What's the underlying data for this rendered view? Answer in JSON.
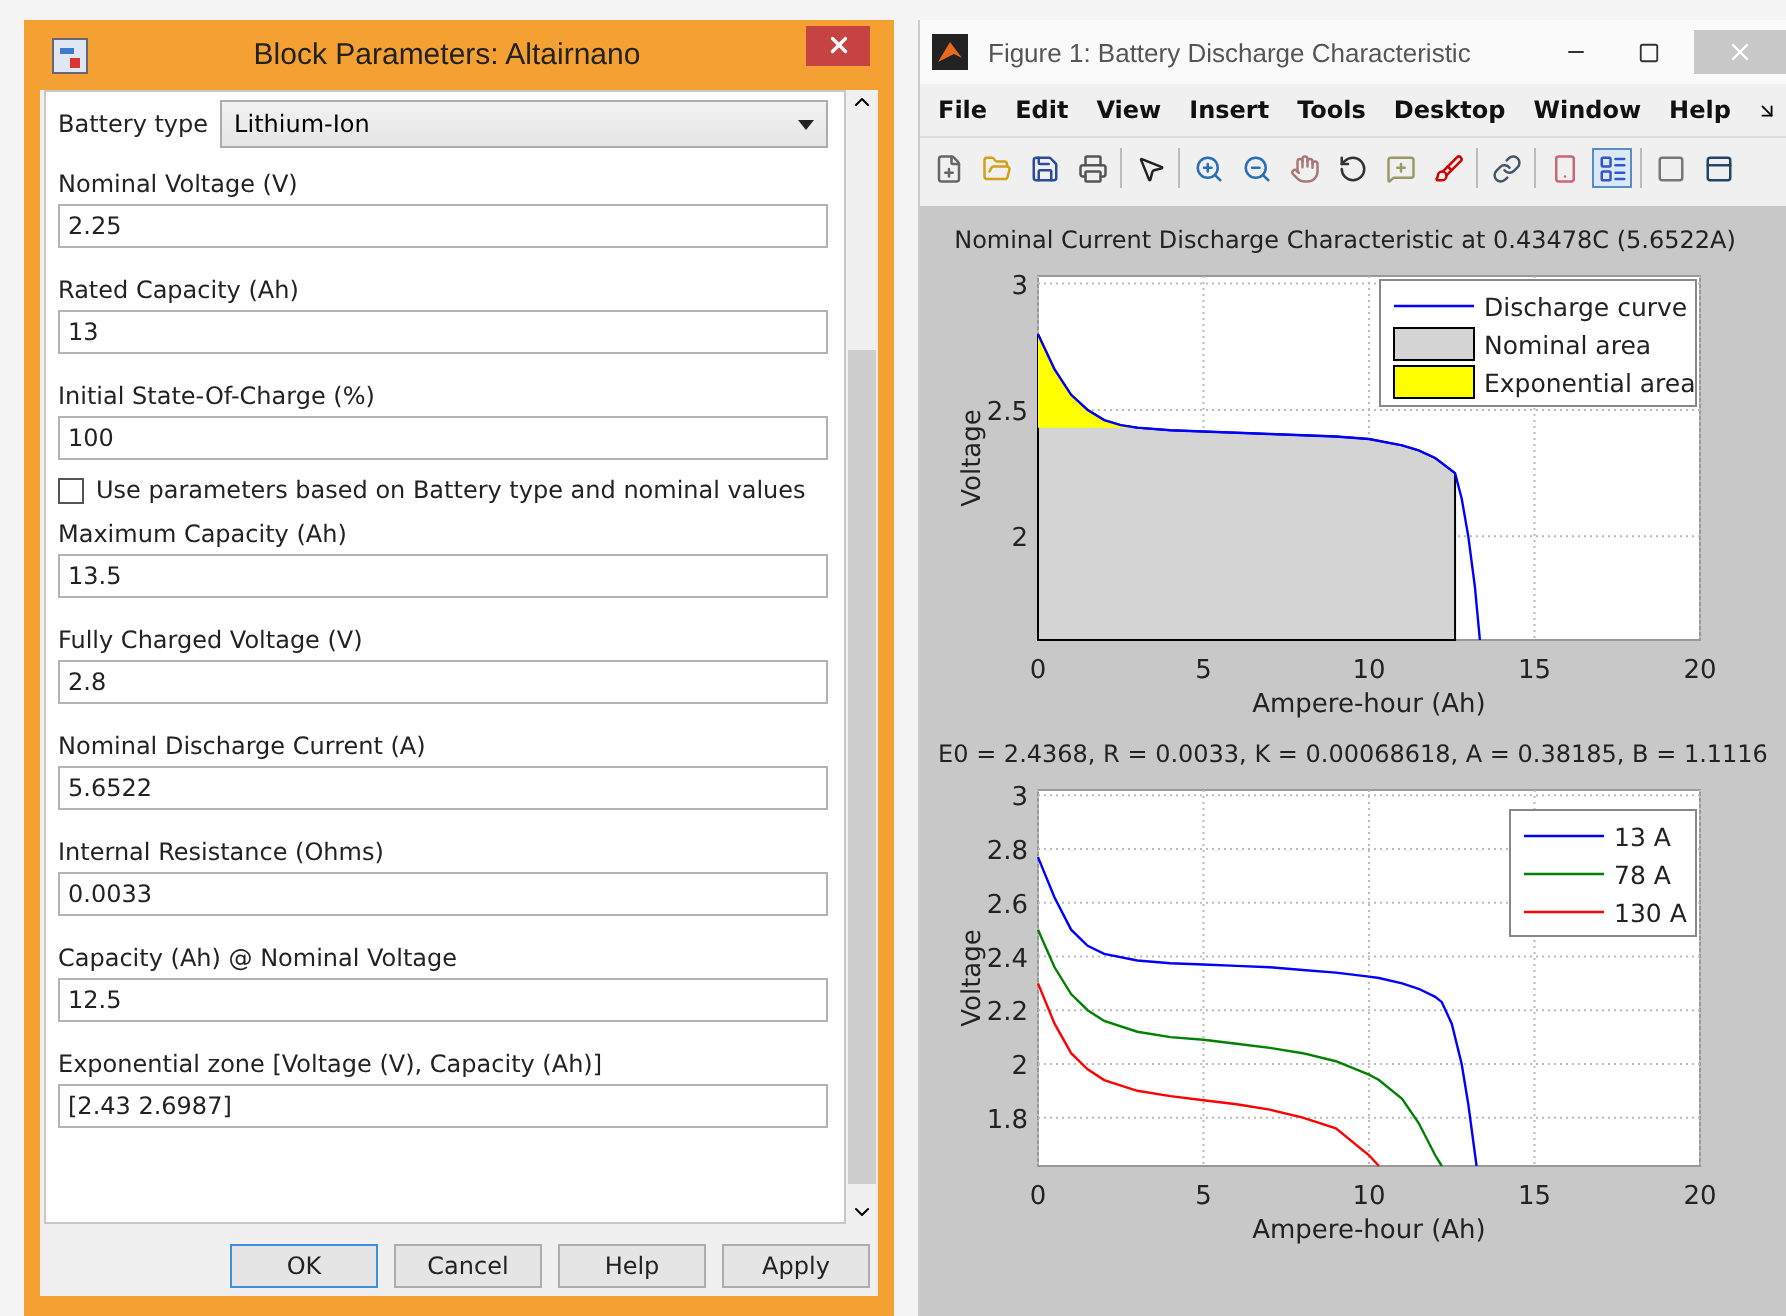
{
  "dialog": {
    "title": "Block Parameters: Altairnano",
    "params": [
      {
        "kind": "dropdown",
        "label": "Battery type",
        "value": "Lithium-Ion"
      },
      {
        "kind": "field",
        "label": "Nominal Voltage (V)",
        "value": "2.25"
      },
      {
        "kind": "field",
        "label": "Rated Capacity (Ah)",
        "value": "13"
      },
      {
        "kind": "field",
        "label": "Initial State-Of-Charge (%)",
        "value": "100"
      },
      {
        "kind": "checkbox",
        "label": "Use parameters based on Battery type and nominal values",
        "checked": false
      },
      {
        "kind": "field",
        "label": "Maximum Capacity (Ah)",
        "value": "13.5"
      },
      {
        "kind": "field",
        "label": "Fully Charged Voltage (V)",
        "value": "2.8"
      },
      {
        "kind": "field",
        "label": "Nominal Discharge Current (A)",
        "value": "5.6522"
      },
      {
        "kind": "field",
        "label": "Internal Resistance (Ohms)",
        "value": "0.0033"
      },
      {
        "kind": "field",
        "label": "Capacity (Ah) @ Nominal Voltage",
        "value": "12.5"
      },
      {
        "kind": "field",
        "label": "Exponential zone [Voltage (V), Capacity (Ah)]",
        "value": "[2.43 2.6987]"
      }
    ],
    "buttons": [
      {
        "label": "OK",
        "selected": true
      },
      {
        "label": "Cancel",
        "selected": false
      },
      {
        "label": "Help",
        "selected": false
      },
      {
        "label": "Apply",
        "selected": false
      }
    ]
  },
  "figure": {
    "title": "Figure 1: Battery Discharge Characteristic",
    "menu": [
      "File",
      "Edit",
      "View",
      "Insert",
      "Tools",
      "Desktop",
      "Window",
      "Help"
    ],
    "toolbar": [
      {
        "kind": "new",
        "selected": false
      },
      {
        "kind": "open",
        "selected": false
      },
      {
        "kind": "save",
        "selected": false
      },
      {
        "kind": "print",
        "selected": false
      },
      {
        "kind": "sep"
      },
      {
        "kind": "pointer",
        "selected": false
      },
      {
        "kind": "sep"
      },
      {
        "kind": "zoom-in",
        "selected": false
      },
      {
        "kind": "zoom-out",
        "selected": false
      },
      {
        "kind": "pan",
        "selected": false
      },
      {
        "kind": "rotate",
        "selected": false
      },
      {
        "kind": "data-cursor",
        "selected": false
      },
      {
        "kind": "brush",
        "selected": false
      },
      {
        "kind": "sep"
      },
      {
        "kind": "link",
        "selected": false
      },
      {
        "kind": "sep"
      },
      {
        "kind": "colorbar",
        "selected": false
      },
      {
        "kind": "legend",
        "selected": true
      },
      {
        "kind": "sep"
      },
      {
        "kind": "hide",
        "selected": false
      },
      {
        "kind": "show",
        "selected": false
      }
    ],
    "plots": [
      {
        "chart_data": {
          "type": "line",
          "title": "Nominal Current Discharge Characteristic at 0.43478C (5.6522A)",
          "xlabel": "Ampere-hour (Ah)",
          "ylabel": "Voltage",
          "x": [
            0,
            0.5,
            1,
            1.5,
            2,
            2.5,
            3,
            4,
            5,
            6,
            7,
            8,
            9,
            10,
            11,
            11.5,
            12,
            12.6,
            12.8,
            13,
            13.2,
            13.35
          ],
          "series": [
            {
              "name": "Discharge curve",
              "color": "#0000ff",
              "values": [
                2.8,
                2.66,
                2.56,
                2.5,
                2.46,
                2.44,
                2.43,
                2.42,
                2.415,
                2.41,
                2.405,
                2.4,
                2.395,
                2.385,
                2.36,
                2.34,
                2.31,
                2.25,
                2.15,
                2.0,
                1.8,
                1.59
              ]
            },
            {
              "name": "Nominal area",
              "type": "area",
              "color": "#d4d4d4",
              "values": [
                2.8,
                2.66,
                2.56,
                2.5,
                2.46,
                2.44,
                2.43,
                2.42,
                2.415,
                2.41,
                2.405,
                2.4,
                2.395,
                2.385,
                2.36,
                2.34,
                2.31,
                2.25,
                null,
                null,
                null,
                null
              ]
            },
            {
              "name": "Exponential area",
              "type": "area",
              "color": "#ffff00",
              "values": [
                2.8,
                2.66,
                2.56,
                2.5,
                2.46,
                2.44,
                2.43,
                null,
                null,
                null,
                null,
                null,
                null,
                null,
                null,
                null,
                null,
                null,
                null,
                null,
                null,
                null
              ]
            }
          ],
          "xlim": [
            0,
            20
          ],
          "ylim": [
            1.59,
            3.03
          ],
          "grid": true,
          "legend": true,
          "xticks": [
            0,
            5,
            10,
            15,
            20
          ],
          "yticks": [
            2,
            2.5,
            3
          ]
        }
      },
      {
        "chart_data": {
          "type": "line",
          "title": "E0 = 2.4368, R = 0.0033, K = 0.00068618, A = 0.38185, B = 1.1116",
          "xlabel": "Ampere-hour (Ah)",
          "ylabel": "Voltage",
          "x": [
            0,
            0.5,
            1,
            1.5,
            2,
            3,
            4,
            5,
            6,
            7,
            8,
            9,
            10,
            10.3,
            11,
            11.5,
            12,
            12.2,
            12.5,
            12.8,
            13,
            13.25
          ],
          "series": [
            {
              "name": "13 A",
              "color": "#0000ff",
              "values": [
                2.77,
                2.62,
                2.5,
                2.44,
                2.41,
                2.385,
                2.375,
                2.37,
                2.365,
                2.36,
                2.35,
                2.34,
                2.325,
                2.32,
                2.3,
                2.28,
                2.25,
                2.23,
                2.15,
                2.0,
                1.85,
                1.62
              ]
            },
            {
              "name": "78 A",
              "color": "#008000",
              "values": [
                2.5,
                2.36,
                2.26,
                2.2,
                2.16,
                2.12,
                2.1,
                2.09,
                2.075,
                2.06,
                2.04,
                2.01,
                1.96,
                1.94,
                1.87,
                1.78,
                1.66,
                1.62,
                null,
                null,
                null,
                null
              ]
            },
            {
              "name": "130 A",
              "color": "#ff0000",
              "values": [
                2.3,
                2.15,
                2.04,
                1.98,
                1.94,
                1.9,
                1.88,
                1.865,
                1.85,
                1.83,
                1.8,
                1.76,
                1.66,
                1.62,
                null,
                null,
                null,
                null,
                null,
                null,
                null,
                null
              ]
            }
          ],
          "xlim": [
            0,
            20
          ],
          "ylim": [
            1.62,
            3.02
          ],
          "grid": true,
          "legend": true,
          "xticks": [
            0,
            5,
            10,
            15,
            20
          ],
          "yticks": [
            1.8,
            2,
            2.2,
            2.4,
            2.6,
            2.8,
            3
          ]
        }
      }
    ]
  }
}
